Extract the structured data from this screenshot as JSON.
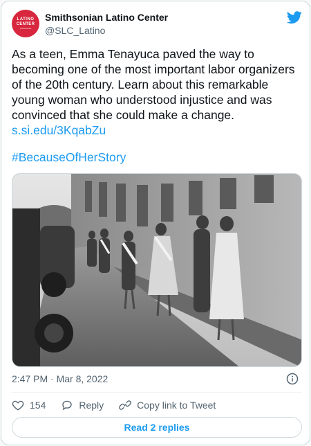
{
  "header": {
    "account_name": "Smithsonian Latino Center",
    "handle": "@SLC_Latino",
    "avatar_line1": "LATINO",
    "avatar_line2": "CENTER",
    "avatar_line3": "Smithsonian",
    "avatar_color": "#d7263d"
  },
  "tweet": {
    "text": "As a teen, Emma Tenayuca paved the way to becoming one of the most important labor organizers of the 20th century. Learn about this remarkable young woman who understood injustice and was convinced that she could make a change. ",
    "link": "s.si.edu/3KqabZu",
    "hashtag": "#BecauseOfHerStory",
    "timestamp": "2:47 PM · Mar 8, 2022"
  },
  "actions": {
    "likes": "154",
    "reply_label": "Reply",
    "copy_label": "Copy link to Tweet",
    "read_replies": "Read 2 replies"
  },
  "colors": {
    "accent": "#1d9bf0",
    "text": "#0f1419",
    "secondary": "#536471"
  }
}
